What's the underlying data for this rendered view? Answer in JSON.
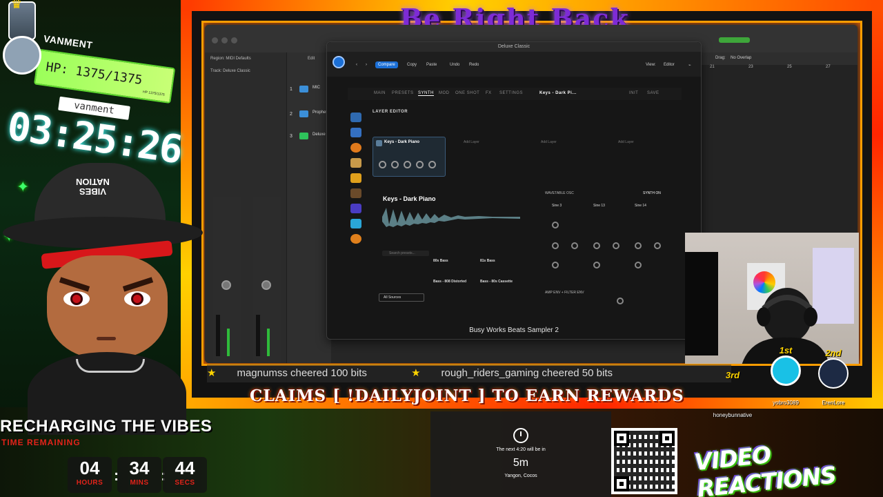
{
  "overlay": {
    "top_title": "Be Right Back",
    "claims_text": "CLAIMS [ !DAILYJOINT ] TO EARN REWARDS",
    "ticker": [
      "magnumss cheered 100 bits",
      "rough_riders_gaming cheered 50 bits"
    ],
    "recharge_title": "RECHARGING THE VIBES",
    "time_remaining_label": "TIME REMAINING",
    "countdown": {
      "hours": "04",
      "hours_label": "HOURS",
      "mins": "34",
      "mins_label": "MINS",
      "secs": "44",
      "secs_label": "SECS"
    },
    "video_reactions": "VIDEO REACTIONS"
  },
  "player_card": {
    "username": "VANMENT",
    "hp": "HP: 1375/1375",
    "hp_mini": "HP 1375/1375",
    "subname": "vanment",
    "clock": "03:25:26"
  },
  "hat": {
    "line1": "VIBES",
    "line2": "NATION"
  },
  "top_supporters": [
    {
      "rank": "1st",
      "name": "yobro3089"
    },
    {
      "rank": "2nd",
      "name": "ErenLore"
    },
    {
      "rank": "3rd",
      "name": "honeybunnative"
    }
  ],
  "notification": {
    "line1": "The next 4:20 will be in",
    "countdown": "5m",
    "location": "Yangon, Cocos"
  },
  "daw": {
    "region_label": "Region: MIDI Defaults",
    "track_label": "Track: Deluxe Classic",
    "edit_menu": "Edit",
    "drag_label": "Drag:",
    "drag_value": "No Overlap",
    "ruler": [
      "21",
      "23",
      "25",
      "27"
    ],
    "tracks": [
      {
        "num": "1",
        "name": "MIC",
        "color": "#3b8fd8"
      },
      {
        "num": "2",
        "name": "Prophet",
        "color": "#3b8fd8"
      },
      {
        "num": "3",
        "name": "Deluxe",
        "color": "#2ec35b"
      }
    ]
  },
  "plugin": {
    "window_title": "Deluxe Classic",
    "toolbar": {
      "compare": "Compare",
      "copy": "Copy",
      "paste": "Paste",
      "undo": "Undo",
      "redo": "Redo",
      "view": "View:",
      "view_value": "Editor"
    },
    "nav": [
      "MAIN",
      "PRESETS",
      "SYNTH",
      "MOD",
      "ONE SHOT",
      "FX",
      "SETTINGS"
    ],
    "current_patch": "Keys - Dark Pi...",
    "nav_right": [
      "INIT",
      "SAVE"
    ],
    "layer_editor": "LAYER EDITOR",
    "layer_card": "Keys - Dark Piano",
    "add_layer": "Add Layer",
    "layer_big": "Keys - Dark Piano",
    "search_placeholder": "Search presets...",
    "presets": [
      "80s Bass",
      "81s Bass",
      "Bass - 808 Distorted",
      "Bass - 80s Cassette"
    ],
    "all_sources": "All Sources",
    "wavetable_label": "WAVETABLE OSC",
    "synth_on": "SYNTH ON",
    "sines": [
      "Sine 3",
      "Sine 13",
      "Sine 14"
    ],
    "amp_label": "AMP ENV + FILTER ENV",
    "footer": "Busy Works Beats Sampler 2"
  }
}
